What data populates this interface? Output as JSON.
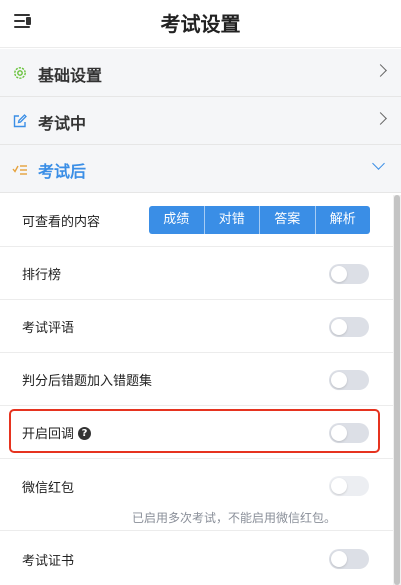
{
  "header": {
    "title": "考试设置",
    "menu_icon": "menu-collapse-icon"
  },
  "sections": [
    {
      "label": "基础设置",
      "icon": "gear-icon",
      "icon_color": "#67c23a",
      "expanded": false
    },
    {
      "label": "考试中",
      "icon": "edit-icon",
      "icon_color": "#3a8ee6",
      "expanded": false
    },
    {
      "label": "考试后",
      "icon": "list-check-icon",
      "icon_color": "#e6a23c",
      "expanded": true
    }
  ],
  "after_exam": {
    "viewable_label": "可查看的内容",
    "viewable_options": [
      "成绩",
      "对错",
      "答案",
      "解析"
    ],
    "rows": [
      {
        "label": "排行榜",
        "enabled": false
      },
      {
        "label": "考试评语",
        "enabled": false
      },
      {
        "label": "判分后错题加入错题集",
        "enabled": false
      },
      {
        "label": "开启回调",
        "enabled": false,
        "help_icon": "question-circle-icon"
      },
      {
        "label": "微信红包",
        "enabled": false,
        "disabled": true,
        "note": "已启用多次考试，不能启用微信红包。"
      },
      {
        "label": "考试证书",
        "enabled": false
      }
    ]
  },
  "colors": {
    "accent": "#3a8ee6",
    "highlight_border": "#e6331f",
    "toggle_off": "#dcdfe6"
  }
}
